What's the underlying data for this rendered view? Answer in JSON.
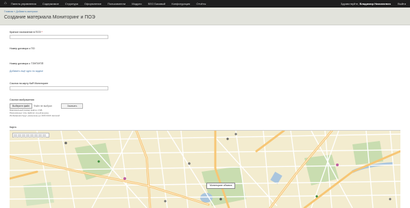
{
  "toolbar": {
    "home_icon": "home-icon",
    "menu": [
      "Панель управления",
      "Содержимое",
      "Структура",
      "Оформление",
      "Пользователи",
      "Модули",
      "SEO Базовый",
      "Конфигурация",
      "Отчёты"
    ],
    "user_prefix": "Здравствуйте,",
    "user_name": "Владимир Николаевич",
    "logout": "Выйти"
  },
  "header": {
    "breadcrumb": "Главная » Добавить материал",
    "title": "Создание материала Мониторинг и ПОЭ"
  },
  "form": {
    "field1_label": "Краткое назначение в ПОЭ",
    "field1_required": "*",
    "field2_label": "Номер договора о ПО",
    "field3_label": "Номер договора о ТЭУП/УПП",
    "add_link": "Добавить ещё одно по задаче",
    "field4_label": "Ссылка на карту КаЯ Мониторинг",
    "file_label": "Ссылки изображения",
    "file_button": "Выберите файл",
    "file_name": "Файл не выбран",
    "upload_button": "Закачать",
    "help1": "Максимальный размер файла: 2 МБ",
    "help2": "Разрешённые типы файлов: png gif jpg jpeg.",
    "help3": "Изображения будут уменьшены до 1024×1024 пикселей"
  },
  "map": {
    "label": "Карта",
    "tooltip": "Мониторинг объекта"
  },
  "colors": {
    "toolbar_bg": "#1e1e1e",
    "header_bg": "#e2e3dc",
    "link": "#4b79a6",
    "map_bg": "#f3eccf",
    "road_major": "#f7c675",
    "park": "#c9ddb0",
    "water": "#a9c5de"
  }
}
